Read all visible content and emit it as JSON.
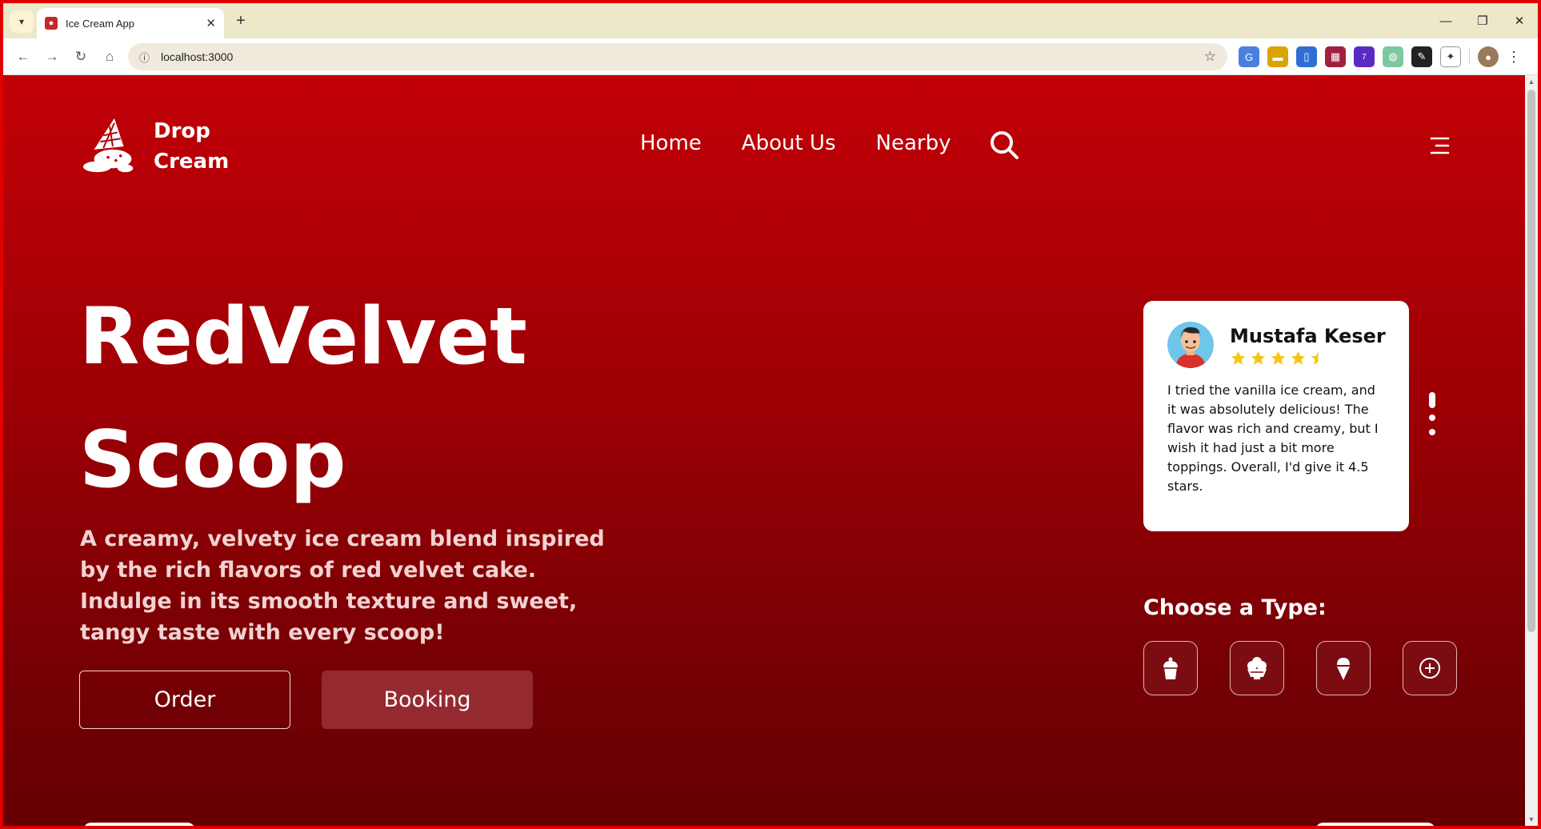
{
  "browser": {
    "tab_title": "Ice Cream App",
    "url": "localhost:3000",
    "new_tab_symbol": "+",
    "extension_badge": "7"
  },
  "header": {
    "brand_line1": "Drop",
    "brand_line2": "Cream",
    "nav": [
      "Home",
      "About Us",
      "Nearby"
    ]
  },
  "hero": {
    "title_line1": "RedVelvet",
    "title_line2": "Scoop",
    "description": "A creamy, velvety ice cream blend inspired by the rich flavors of red velvet cake. Indulge in its smooth texture and sweet, tangy taste with every scoop!",
    "order_label": "Order",
    "booking_label": "Booking"
  },
  "review": {
    "name": "Mustafa Keser",
    "rating": 4.5,
    "text": "I tried the vanilla ice cream, and it was absolutely delicious! The flavor was rich and creamy, but I wish it had just a bit more toppings. Overall, I'd give it 4.5 stars."
  },
  "types": {
    "title": "Choose a Type:",
    "items": [
      "cup-icon",
      "sundae-icon",
      "cone-icon",
      "add-icon"
    ]
  },
  "colors": {
    "accent": "#c20007",
    "accent_dark": "#650003",
    "star": "#f5c518",
    "booking_bg": "#942a2f"
  }
}
